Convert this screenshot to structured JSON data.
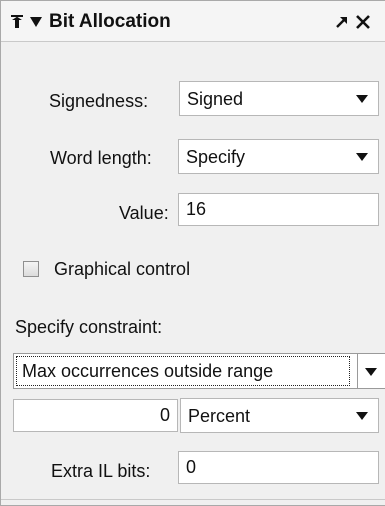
{
  "panel": {
    "title": "Bit Allocation",
    "icons": {
      "pin": "pin-icon",
      "collapse": "collapse-triangle-icon",
      "undock": "undock-arrow-icon",
      "close": "close-icon",
      "dropdown": "chevron-down-icon"
    }
  },
  "signedness": {
    "label": "Signedness:",
    "value": "Signed"
  },
  "word_length": {
    "label": "Word length:",
    "value": "Specify"
  },
  "value_field": {
    "label": "Value:",
    "value": "16"
  },
  "graphical_control": {
    "label": "Graphical control",
    "checked": false
  },
  "constraint": {
    "label": "Specify constraint:",
    "value": "Max occurrences outside range"
  },
  "occurrences": {
    "amount": "0",
    "unit": "Percent"
  },
  "extra_il_bits": {
    "label": "Extra IL bits:",
    "value": "0"
  }
}
